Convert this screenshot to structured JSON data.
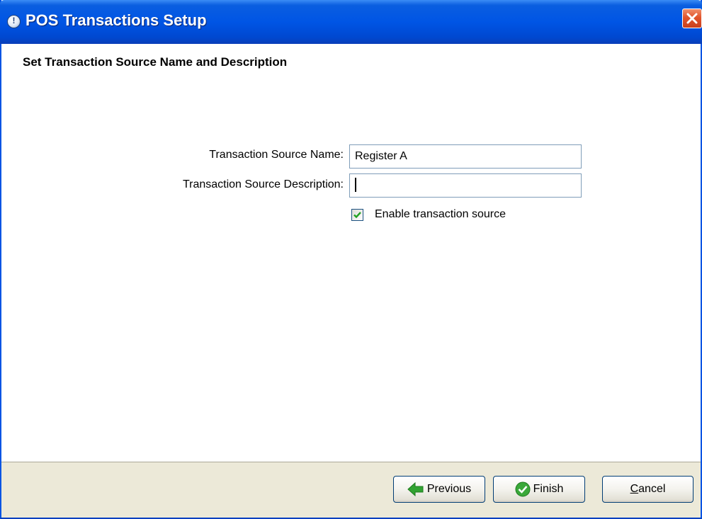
{
  "window": {
    "title": "POS Transactions Setup",
    "close_icon": "close-icon",
    "app_icon": "app-info-icon"
  },
  "page": {
    "heading": "Set Transaction Source Name and Description"
  },
  "form": {
    "name_label": "Transaction Source Name:",
    "name_value": "Register A",
    "description_label": "Transaction Source Description:",
    "description_value": "",
    "enable_label": "Enable transaction source",
    "enable_checked": true
  },
  "buttons": {
    "previous": "Previous",
    "finish": "Finish",
    "cancel": "Cancel"
  },
  "colors": {
    "titlebar": "#0055e5",
    "footer": "#ece9d8",
    "close": "#e2542c",
    "previous_arrow": "#2e9e2e",
    "finish_check": "#3aa83a"
  }
}
